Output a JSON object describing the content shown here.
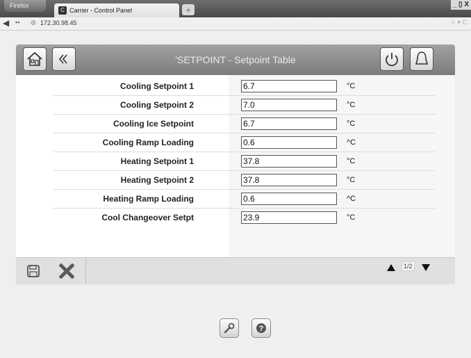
{
  "browser": {
    "app_button": "Firefox",
    "tab_title": "Carrier - Control Panel",
    "new_tab": "+",
    "url": "172.30.98.45",
    "window_controls": "_ ▯ X"
  },
  "header": {
    "title": "'SETPOINT - Setpoint Table"
  },
  "setpoints": [
    {
      "label": "Cooling Setpoint 1",
      "value": "6.7",
      "unit": "°C"
    },
    {
      "label": "Cooling Setpoint 2",
      "value": "7.0",
      "unit": "°C"
    },
    {
      "label": "Cooling Ice Setpoint",
      "value": "6.7",
      "unit": "°C"
    },
    {
      "label": "Cooling Ramp Loading",
      "value": "0.6",
      "unit": "^C"
    },
    {
      "label": "Heating Setpoint 1",
      "value": "37.8",
      "unit": "°C"
    },
    {
      "label": "Heating Setpoint 2",
      "value": "37.8",
      "unit": "°C"
    },
    {
      "label": "Heating Ramp Loading",
      "value": "0.6",
      "unit": "^C"
    },
    {
      "label": "Cool Changeover Setpt",
      "value": "23.9",
      "unit": "°C"
    }
  ],
  "pager": {
    "text": "1/2"
  },
  "icons": {
    "home": "home-icon",
    "back": "chevron-double-left-icon",
    "power": "power-icon",
    "alarm": "bell-icon",
    "save": "floppy-disk-icon",
    "cancel": "x-icon",
    "tools": "wrench-icon",
    "help": "question-icon"
  },
  "colors": {
    "header": "#8f8f8f",
    "background": "#efefef",
    "footer": "#e0e0e0"
  }
}
